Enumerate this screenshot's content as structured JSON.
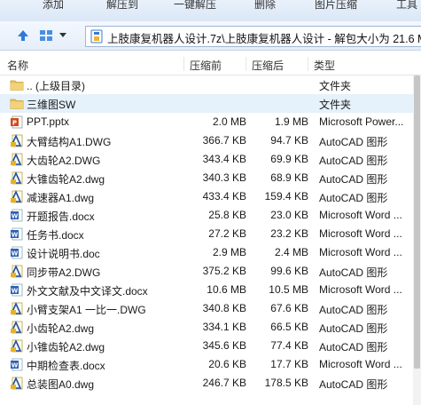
{
  "toolbar": {
    "buttons": [
      "添加",
      "解压到",
      "一键解压",
      "删除",
      "图片压缩",
      "工具"
    ]
  },
  "address": {
    "path": "上肢康复机器人设计.7z\\上肢康复机器人设计 - 解包大小为 21.6 M"
  },
  "columns": {
    "name": "名称",
    "packed": "压缩前",
    "size": "压缩后",
    "type": "类型"
  },
  "files": [
    {
      "name": ".. (上级目录)",
      "packed": "",
      "size": "",
      "type": "文件夹",
      "icon": "folder-icon"
    },
    {
      "name": "三维图SW",
      "packed": "",
      "size": "",
      "type": "文件夹",
      "icon": "folder-icon"
    },
    {
      "name": "PPT.pptx",
      "packed": "2.0 MB",
      "size": "1.9 MB",
      "type": "Microsoft Power...",
      "icon": "powerpoint-icon"
    },
    {
      "name": "大臂结构A1.DWG",
      "packed": "366.7 KB",
      "size": "94.7 KB",
      "type": "AutoCAD 图形",
      "icon": "dwg-icon"
    },
    {
      "name": "大齿轮A2.DWG",
      "packed": "343.4 KB",
      "size": "69.9 KB",
      "type": "AutoCAD 图形",
      "icon": "dwg-icon"
    },
    {
      "name": "大锥齿轮A2.dwg",
      "packed": "340.3 KB",
      "size": "68.9 KB",
      "type": "AutoCAD 图形",
      "icon": "dwg-icon"
    },
    {
      "name": "减速器A1.dwg",
      "packed": "433.4 KB",
      "size": "159.4 KB",
      "type": "AutoCAD 图形",
      "icon": "dwg-icon"
    },
    {
      "name": "开题报告.docx",
      "packed": "25.8 KB",
      "size": "23.0 KB",
      "type": "Microsoft Word ...",
      "icon": "word-icon"
    },
    {
      "name": "任务书.docx",
      "packed": "27.2 KB",
      "size": "23.2 KB",
      "type": "Microsoft Word ...",
      "icon": "word-icon"
    },
    {
      "name": "设计说明书.doc",
      "packed": "2.9 MB",
      "size": "2.4 MB",
      "type": "Microsoft Word ...",
      "icon": "word-icon"
    },
    {
      "name": "同步带A2.DWG",
      "packed": "375.2 KB",
      "size": "99.6 KB",
      "type": "AutoCAD 图形",
      "icon": "dwg-icon"
    },
    {
      "name": "外文文献及中文译文.docx",
      "packed": "10.6 MB",
      "size": "10.5 MB",
      "type": "Microsoft Word ...",
      "icon": "word-icon"
    },
    {
      "name": "小臂支架A1 一比一.DWG",
      "packed": "340.8 KB",
      "size": "67.6 KB",
      "type": "AutoCAD 图形",
      "icon": "dwg-icon"
    },
    {
      "name": "小齿轮A2.dwg",
      "packed": "334.1 KB",
      "size": "66.5 KB",
      "type": "AutoCAD 图形",
      "icon": "dwg-icon"
    },
    {
      "name": "小锥齿轮A2.dwg",
      "packed": "345.6 KB",
      "size": "77.4 KB",
      "type": "AutoCAD 图形",
      "icon": "dwg-icon"
    },
    {
      "name": "中期检查表.docx",
      "packed": "20.6 KB",
      "size": "17.7 KB",
      "type": "Microsoft Word ...",
      "icon": "word-icon"
    },
    {
      "name": "总装图A0.dwg",
      "packed": "246.7 KB",
      "size": "178.5 KB",
      "type": "AutoCAD 图形",
      "icon": "dwg-icon"
    }
  ],
  "selected_index": 1
}
